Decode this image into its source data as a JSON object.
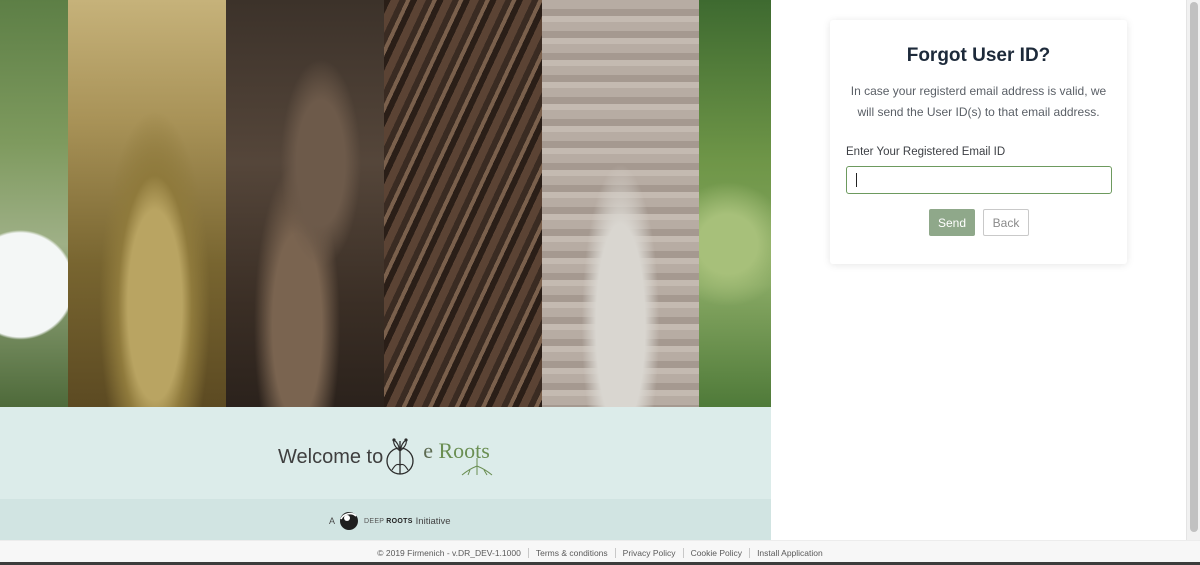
{
  "hero": {
    "welcome_text": "Welcome to",
    "brand_prefix": "e",
    "brand_name": "Roots",
    "initiative": {
      "prefix": "A",
      "deep": "DEEP",
      "roots": "ROOTS",
      "word": "Initiative"
    }
  },
  "card": {
    "title": "Forgot User ID?",
    "message": "In case your registerd email address is valid, we will send the User ID(s) to that email address.",
    "email_label": "Enter Your Registered Email ID",
    "email_value": "",
    "send_label": "Send",
    "back_label": "Back"
  },
  "footer": {
    "copyright": "© 2019 Firmenich - v.DR_DEV-1.1000",
    "links": [
      "Terms & conditions",
      "Privacy Policy",
      "Cookie Policy",
      "Install Application"
    ]
  },
  "colors": {
    "accent": "#8fa88a",
    "input_border": "#6d9a5e",
    "welcome_band": "#dcecea",
    "title": "#1d2a3a"
  }
}
